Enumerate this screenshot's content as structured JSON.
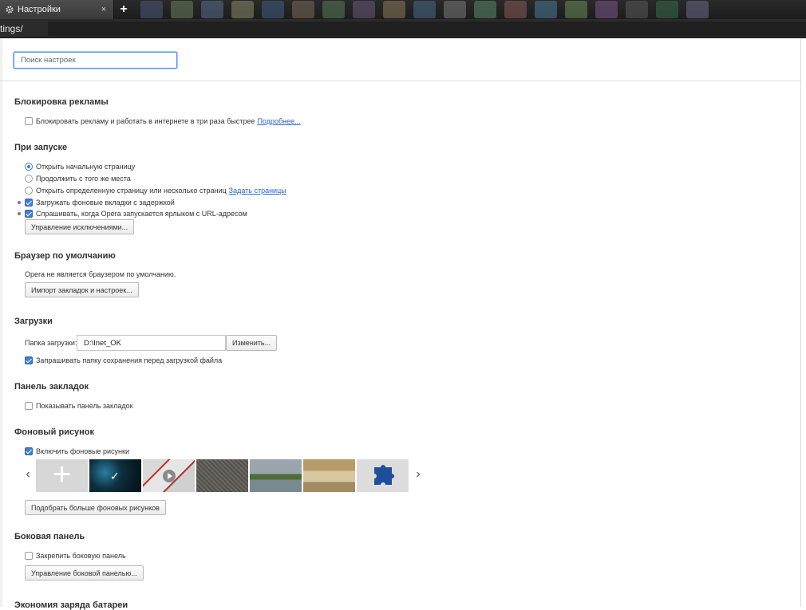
{
  "tab": {
    "title": "Настройки",
    "close": "×",
    "new_tab": "+"
  },
  "address": {
    "text": "tings/"
  },
  "search": {
    "placeholder": "Поиск настроек"
  },
  "ad_block": {
    "title": "Блокировка рекламы",
    "option": "Блокировать рекламу и работать в интернете в три раза быстрее",
    "more_link": "Подробнее...",
    "checked": false
  },
  "startup": {
    "title": "При запуске",
    "radios": [
      {
        "label": "Открыть начальную страницу",
        "selected": true
      },
      {
        "label": "Продолжить с того же места",
        "selected": false
      },
      {
        "label": "Открыть определенную страницу или несколько страниц",
        "selected": false,
        "link": "Задать страницы"
      }
    ],
    "checks": [
      {
        "label": "Загружать фоновые вкладки с задержкой",
        "checked": true
      },
      {
        "label": "Спрашивать, когда Opera запускается ярлыком с URL-адресом",
        "checked": true
      }
    ],
    "exceptions_button": "Управление исключениями..."
  },
  "default_browser": {
    "title": "Браузер по умолчанию",
    "status": "Opera не является браузером по умолчанию.",
    "import_button": "Импорт закладок и настроек..."
  },
  "downloads": {
    "title": "Загрузки",
    "folder_label": "Папка загрузки:",
    "folder_value": "D:\\Inet_OK",
    "change_button": "Изменить...",
    "ask_label": "Запрашивать папку сохранения перед загрузкой файла",
    "ask_checked": true
  },
  "bookmarks_bar": {
    "title": "Панель закладок",
    "show_label": "Показывать панель закладок",
    "show_checked": false
  },
  "wallpaper": {
    "title": "Фоновый рисунок",
    "enable_label": "Включить фоновые рисунки",
    "enable_checked": true,
    "prev": "‹",
    "next": "›",
    "add_symbol": "+",
    "selected_symbol": "✓",
    "more_button": "Подобрать больше фоновых рисунков"
  },
  "sidebar": {
    "title": "Боковая панель",
    "pin_label": "Закрепить боковую панель",
    "pin_checked": false,
    "manage_button": "Управление боковой панелью..."
  },
  "battery": {
    "title": "Экономия заряда батареи"
  },
  "colors": {
    "accent": "#3f7fd1",
    "link": "#2a66c9",
    "focus": "#4d90fe"
  }
}
